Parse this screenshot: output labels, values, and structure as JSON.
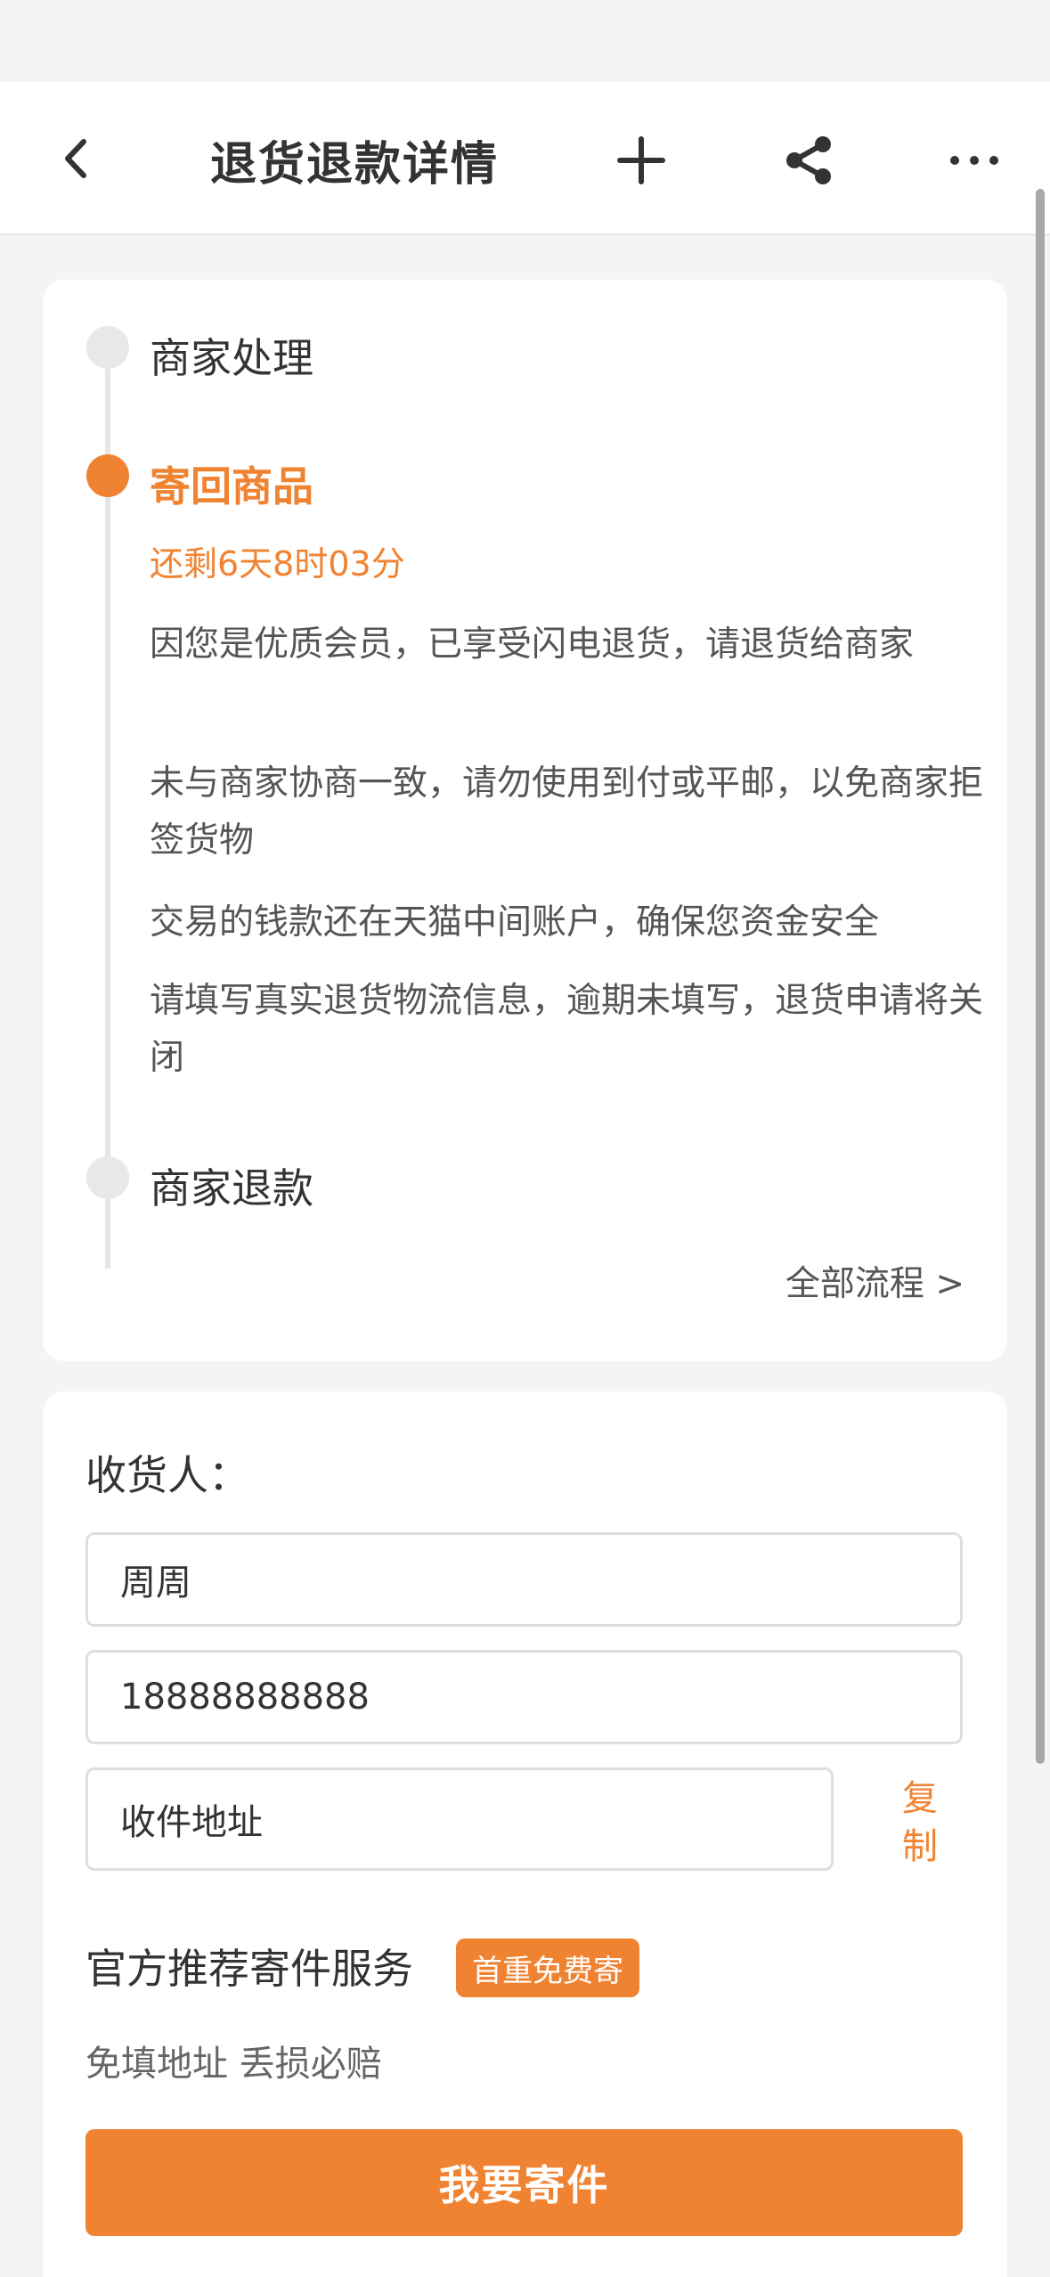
{
  "header": {
    "title": "退货退款详情",
    "icons": [
      "back-icon",
      "plus-icon",
      "share-icon",
      "more-icon"
    ]
  },
  "progress": {
    "steps": [
      {
        "label": "商家处理",
        "state": "done"
      },
      {
        "label": "寄回商品",
        "state": "current"
      },
      {
        "label": "商家退款",
        "state": "pending"
      }
    ],
    "countdown": "还剩6天8时03分",
    "notes": [
      "因您是优质会员，已享受闪电退货，请退货给商家",
      "未与商家协商一致，请勿使用到付或平邮，以免商家拒签货物",
      "交易的钱款还在天猫中间账户，确保您资金安全",
      "请填写真实退货物流信息，逾期未填写，退货申请将关闭"
    ],
    "all_flow_link": "全部流程 >"
  },
  "receiver": {
    "label": "收货人：",
    "name": "周周",
    "phone": "18888888888",
    "address": "收件地址",
    "copy_label": "复制"
  },
  "service": {
    "title": "官方推荐寄件服务",
    "badge": "首重免费寄",
    "subtitle": "免填地址 丢损必赔",
    "button": "我要寄件"
  },
  "colors": {
    "accent": "#f08332",
    "background": "#f4f4f4",
    "card": "#ffffff"
  }
}
